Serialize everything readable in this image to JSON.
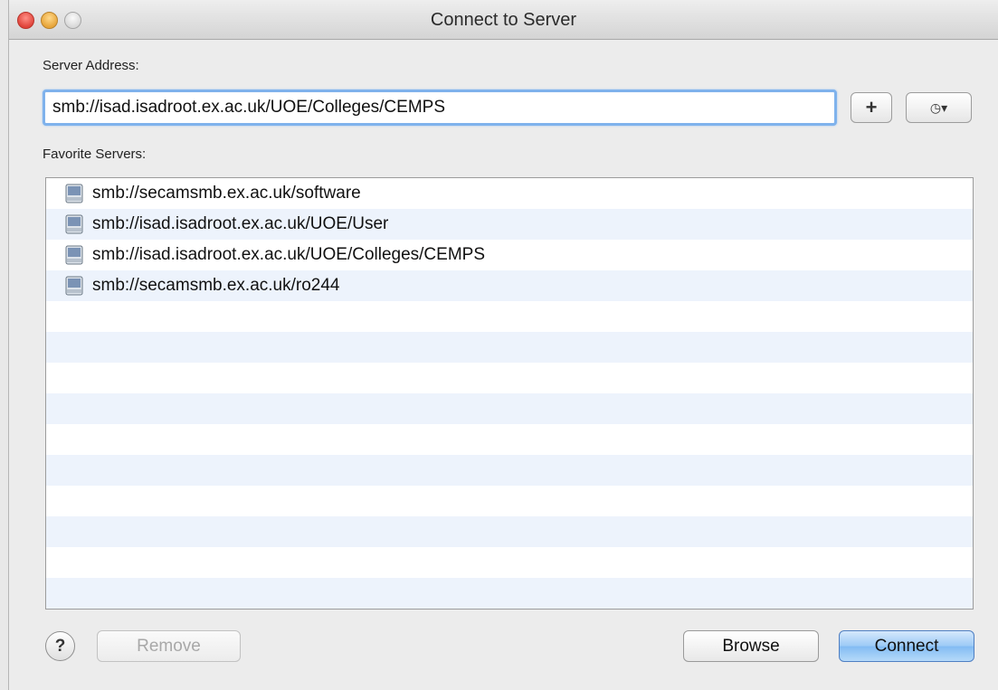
{
  "window": {
    "title": "Connect to Server"
  },
  "server_address": {
    "label": "Server Address:",
    "value": "smb://isad.isadroot.ex.ac.uk/UOE/Colleges/CEMPS",
    "add_button_label": "+",
    "recent_button_glyph": "◷▾"
  },
  "favorites": {
    "label": "Favorite Servers:",
    "items": [
      {
        "text": "smb://secamsmb.ex.ac.uk/software",
        "icon": "network-drive-icon"
      },
      {
        "text": "smb://isad.isadroot.ex.ac.uk/UOE/User",
        "icon": "network-drive-icon"
      },
      {
        "text": "smb://isad.isadroot.ex.ac.uk/UOE/Colleges/CEMPS",
        "icon": "network-drive-icon"
      },
      {
        "text": "smb://secamsmb.ex.ac.uk/ro244",
        "icon": "network-drive-icon"
      }
    ]
  },
  "buttons": {
    "help": "?",
    "remove": "Remove",
    "browse": "Browse",
    "connect": "Connect"
  },
  "colors": {
    "focus_ring": "#7fb2ec",
    "default_button": "#9ccaf6",
    "list_stripe": "#edf3fc"
  }
}
